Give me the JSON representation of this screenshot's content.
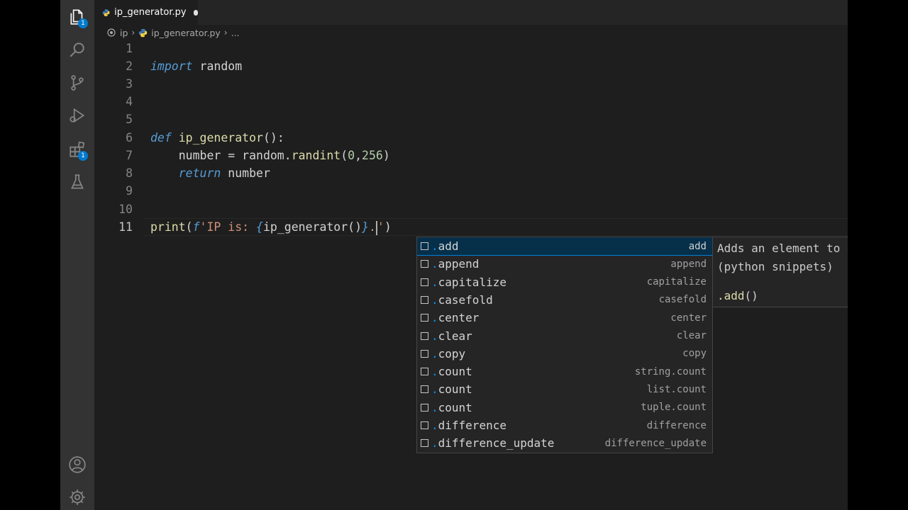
{
  "activity_bar": {
    "explorer_badge": "1",
    "extensions_badge": "1"
  },
  "tab": {
    "label": "ip_generator.py"
  },
  "breadcrumb": {
    "folder": "ip",
    "file": "ip_generator.py",
    "more": "..."
  },
  "code_lines": [
    {
      "n": "1"
    },
    {
      "n": "2",
      "t": [
        [
          "kw",
          "import"
        ],
        [
          "",
          ""
        ],
        [
          "",
          " random"
        ]
      ]
    },
    {
      "n": "3"
    },
    {
      "n": "4"
    },
    {
      "n": "5"
    },
    {
      "n": "6"
    },
    {
      "n": "7"
    },
    {
      "n": "8"
    },
    {
      "n": "9"
    },
    {
      "n": "10"
    },
    {
      "n": "11"
    }
  ],
  "code": {
    "l2_kw": "import",
    "l2_rest": " random",
    "l6_kw": "def",
    "l6_fn": "ip_generator",
    "l6_rest": "():",
    "l7_a": "    number = random.",
    "l7_fn": "randint",
    "l7_b": "(",
    "l7_n1": "0",
    "l7_c": ",",
    "l7_n2": "256",
    "l7_d": ")",
    "l8_kw": "    return",
    "l8_rest": " number",
    "l11_fn": "print",
    "l11_a": "(",
    "l11_kw": "f",
    "l11_s1": "'IP is: ",
    "l11_b1": "{",
    "l11_call": "ip_generator()",
    "l11_b2": "}",
    "l11_s2": ".",
    "l11_q": "'",
    "l11_end": ")"
  },
  "suggestions": [
    {
      "label": "add",
      "detail": "add"
    },
    {
      "label": "append",
      "detail": "append"
    },
    {
      "label": "capitalize",
      "detail": "capitalize"
    },
    {
      "label": "casefold",
      "detail": "casefold"
    },
    {
      "label": "center",
      "detail": "center"
    },
    {
      "label": "clear",
      "detail": "clear"
    },
    {
      "label": "copy",
      "detail": "copy"
    },
    {
      "label": "count",
      "detail": "string.count"
    },
    {
      "label": "count",
      "detail": "list.count"
    },
    {
      "label": "count",
      "detail": "tuple.count"
    },
    {
      "label": "difference",
      "detail": "difference"
    },
    {
      "label": "difference_update",
      "detail": "difference_update"
    }
  ],
  "doc": {
    "line1": "Adds an element to the",
    "line2": "(python snippets)",
    "code_name": ".add",
    "code_parens": "()"
  },
  "colors": {
    "accent": "#007acc",
    "selection": "#062f4a",
    "keyword": "#569cd6",
    "function": "#dcdcaa",
    "number": "#b5cea8",
    "string": "#ce9178"
  }
}
